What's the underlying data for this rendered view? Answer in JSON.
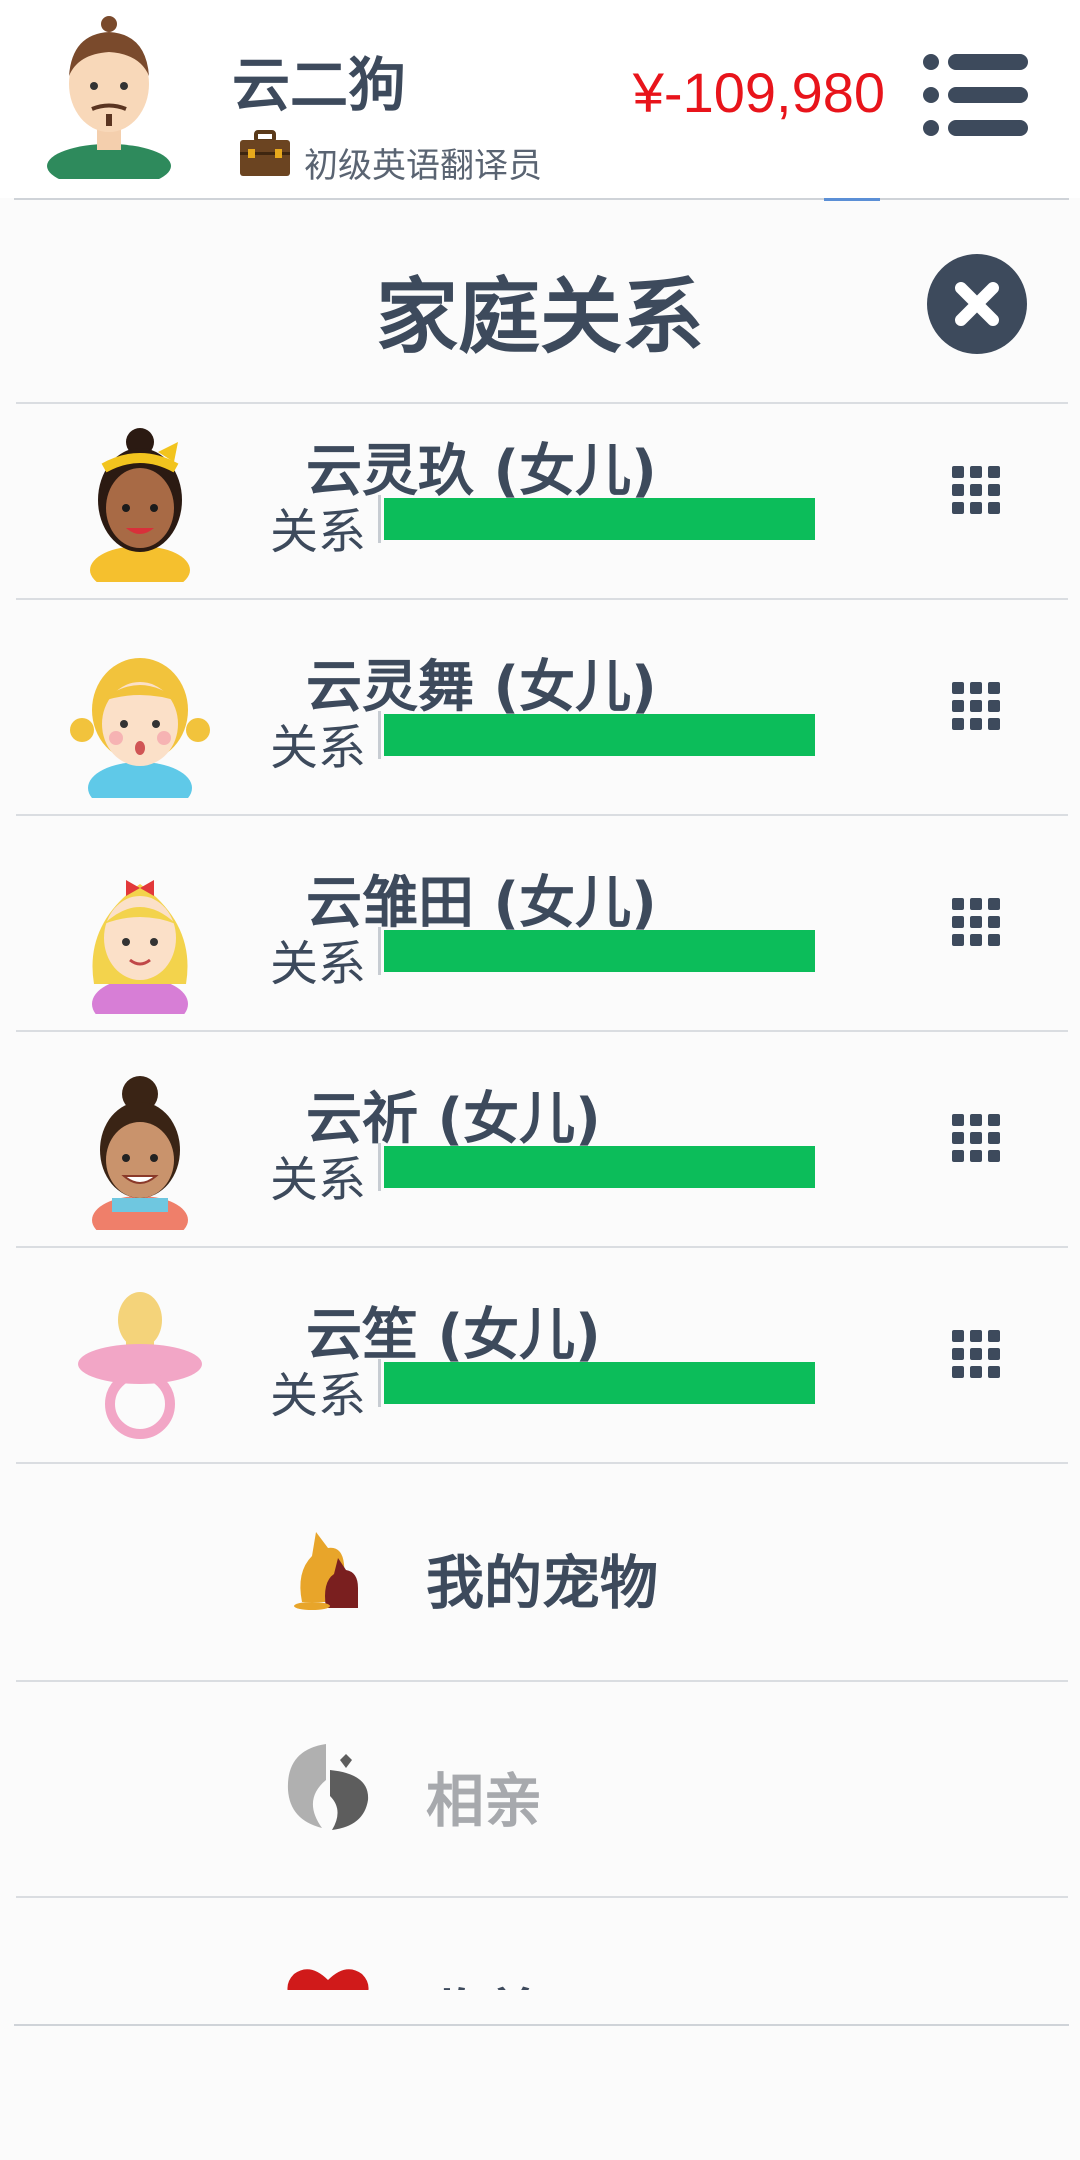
{
  "player": {
    "name": "云二狗",
    "job": "初级英语翻译员",
    "money": "¥-109,980"
  },
  "section": {
    "title": "家庭关系"
  },
  "relation_label": "关系",
  "family": [
    {
      "name": "云灵玖 (女儿)",
      "relation": 1.0,
      "avatar_icon": "girl-dark-headband-avatar"
    },
    {
      "name": "云灵舞 (女儿)",
      "relation": 1.0,
      "avatar_icon": "girl-blonde-pigtails-avatar"
    },
    {
      "name": "云雏田 (女儿)",
      "relation": 1.0,
      "avatar_icon": "girl-blonde-bow-avatar"
    },
    {
      "name": "云祈 (女儿)",
      "relation": 1.0,
      "avatar_icon": "girl-bun-avatar"
    },
    {
      "name": "云笙 (女儿)",
      "relation": 1.0,
      "avatar_icon": "baby-pacifier-avatar"
    }
  ],
  "menu": [
    {
      "label": "我的宠物",
      "icon": "pet-dog-icon",
      "enabled": true
    },
    {
      "label": "相亲",
      "icon": "matchmaking-icon",
      "enabled": false
    },
    {
      "label": "收养",
      "icon": "heart-icon",
      "enabled": true
    }
  ],
  "colors": {
    "money": "#e8141b",
    "relation_bar": "#0cbd5a",
    "text": "#3d4a5c",
    "disabled": "#a7a9ad"
  }
}
